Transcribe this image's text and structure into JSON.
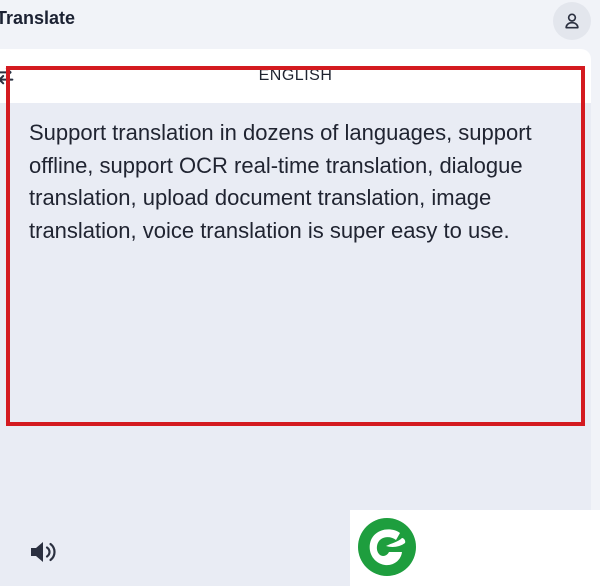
{
  "header": {
    "title": "Translate",
    "account_icon": "person-icon"
  },
  "translate_card": {
    "language_label": "ENGLISH",
    "swap_icon": "swap-arrows-icon",
    "source_text": "Support translation in dozens of languages, support offline, support OCR real-time translation, dialogue translation, upload document translation, image translation, voice translation is super easy to use.",
    "speaker_icon": "speaker-icon"
  },
  "overlay": {
    "highlight_color": "#d41a20",
    "logo_icon": "green-leaf-logo-icon",
    "logo_color": "#1e9e3e"
  },
  "colors": {
    "background": "#f1f3f8",
    "card": "#e9ecf4",
    "text": "#202431"
  }
}
